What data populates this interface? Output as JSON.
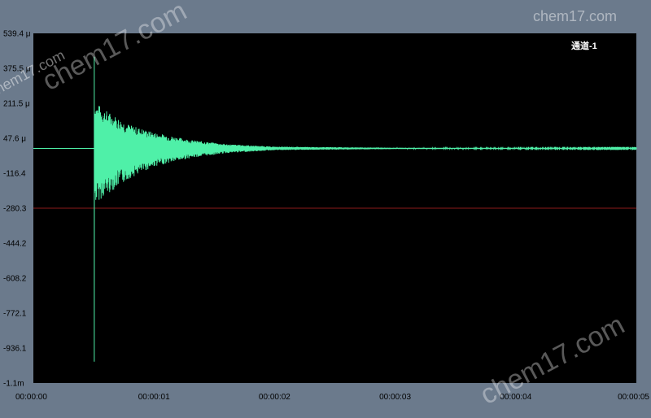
{
  "chart_data": {
    "type": "line",
    "channel_label": "通道-1",
    "y_ticks": [
      "539.4 μ",
      "375.5 μ",
      "211.5 μ",
      "47.6 μ",
      "-116.4",
      "-280.3",
      "-444.2",
      "-608.2",
      "-772.1",
      "-936.1",
      "-1.1m"
    ],
    "x_ticks": [
      "00:00:00",
      "00:00:01",
      "00:00:02",
      "00:00:03",
      "00:00:04",
      "00:00:05"
    ],
    "xlim": [
      0,
      5
    ],
    "ylim": [
      -1.1,
      0.5394
    ],
    "baseline": 0.0,
    "reference_line": {
      "value": -0.2803,
      "color": "#8b1a1a"
    },
    "series": [
      {
        "color": "#4ff0a8",
        "impulse_time": 0.505,
        "impulse_max": 0.43,
        "impulse_min": -1.0,
        "envelope": [
          {
            "t": 0.505,
            "upper": 0.22,
            "lower": -0.26
          },
          {
            "t": 0.6,
            "upper": 0.18,
            "lower": -0.22
          },
          {
            "t": 0.8,
            "upper": 0.11,
            "lower": -0.14
          },
          {
            "t": 1.0,
            "upper": 0.075,
            "lower": -0.085
          },
          {
            "t": 1.3,
            "upper": 0.04,
            "lower": -0.045
          },
          {
            "t": 1.6,
            "upper": 0.02,
            "lower": -0.022
          },
          {
            "t": 2.0,
            "upper": 0.008,
            "lower": -0.008
          },
          {
            "t": 3.0,
            "upper": 0.003,
            "lower": -0.003
          },
          {
            "t": 5.0,
            "upper": 0.002,
            "lower": -0.002
          }
        ]
      }
    ],
    "grid": false
  },
  "watermarks": [
    "chem17.com",
    "chem17.com",
    "chem17.com",
    "chem17.com"
  ],
  "colors": {
    "plot_background": "#000000",
    "frame_background": "#6b7a8c",
    "signal": "#4ff0a8"
  }
}
